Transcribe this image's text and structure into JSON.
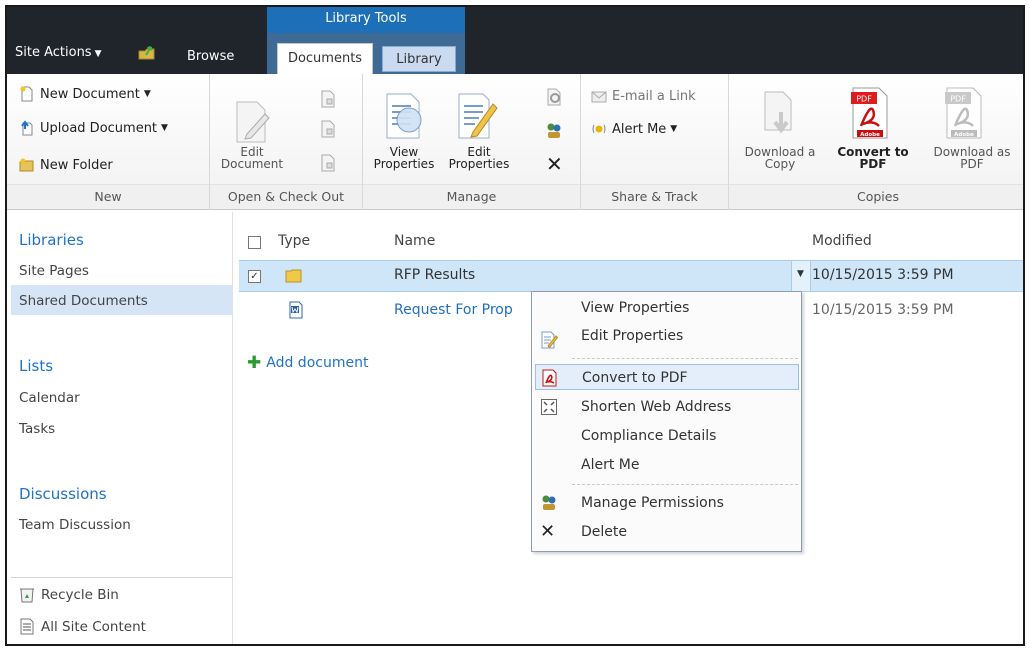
{
  "topbar": {
    "site_actions": "Site Actions",
    "browse_tab": "Browse",
    "library_tools": "Library Tools",
    "tabs": [
      {
        "label": "Documents",
        "selected": true
      },
      {
        "label": "Library",
        "selected": false
      }
    ]
  },
  "ribbon": {
    "new": {
      "group": "New",
      "new_document": "New Document",
      "upload_document": "Upload Document",
      "new_folder": "New Folder"
    },
    "open": {
      "group": "Open & Check Out",
      "edit_document_1": "Edit",
      "edit_document_2": "Document"
    },
    "manage": {
      "group": "Manage",
      "view_properties_1": "View",
      "view_properties_2": "Properties",
      "edit_properties_1": "Edit",
      "edit_properties_2": "Properties"
    },
    "share": {
      "group": "Share & Track",
      "email_link": "E-mail a Link",
      "alert_me": "Alert Me"
    },
    "copies": {
      "group": "Copies",
      "download_copy_1": "Download a",
      "download_copy_2": "Copy",
      "convert_pdf_1": "Convert to",
      "convert_pdf_2": "PDF",
      "download_pdf_1": "Download as",
      "download_pdf_2": "PDF",
      "pdf_badge": "PDF",
      "adobe_badge": "Adobe"
    }
  },
  "leftnav": {
    "libraries": "Libraries",
    "site_pages": "Site Pages",
    "shared_documents": "Shared Documents",
    "lists": "Lists",
    "calendar": "Calendar",
    "tasks": "Tasks",
    "discussions": "Discussions",
    "team_discussion": "Team Discussion",
    "recycle_bin": "Recycle Bin",
    "all_site_content": "All Site Content"
  },
  "list": {
    "columns": {
      "type": "Type",
      "name": "Name",
      "modified": "Modified"
    },
    "rows": [
      {
        "name": "RFP Results",
        "modified": "10/15/2015 3:59 PM",
        "kind": "folder",
        "checked": true
      },
      {
        "name": "Request For Prop",
        "modified": "10/15/2015 3:59 PM",
        "kind": "word",
        "checked": false
      }
    ],
    "add_document": "Add document"
  },
  "context_menu": {
    "items": [
      {
        "label": "View Properties",
        "icon": ""
      },
      {
        "label": "Edit Properties",
        "icon": "edit-properties-icon"
      },
      {
        "label": "Convert to PDF",
        "icon": "pdf-icon",
        "highlighted": true
      },
      {
        "label": "Shorten Web Address",
        "icon": "shorten-url-icon"
      },
      {
        "label": "Compliance Details",
        "icon": ""
      },
      {
        "label": "Alert Me",
        "icon": ""
      },
      {
        "label": "Manage Permissions",
        "icon": "permissions-icon"
      },
      {
        "label": "Delete",
        "icon": "delete-icon"
      }
    ]
  },
  "colors": {
    "topbar": "#20242b",
    "library_tools": "#1d6fb8",
    "nav_heading": "#1f73c7",
    "row_selected": "#cfe6f8",
    "menu_highlight": "#e3eefa"
  }
}
